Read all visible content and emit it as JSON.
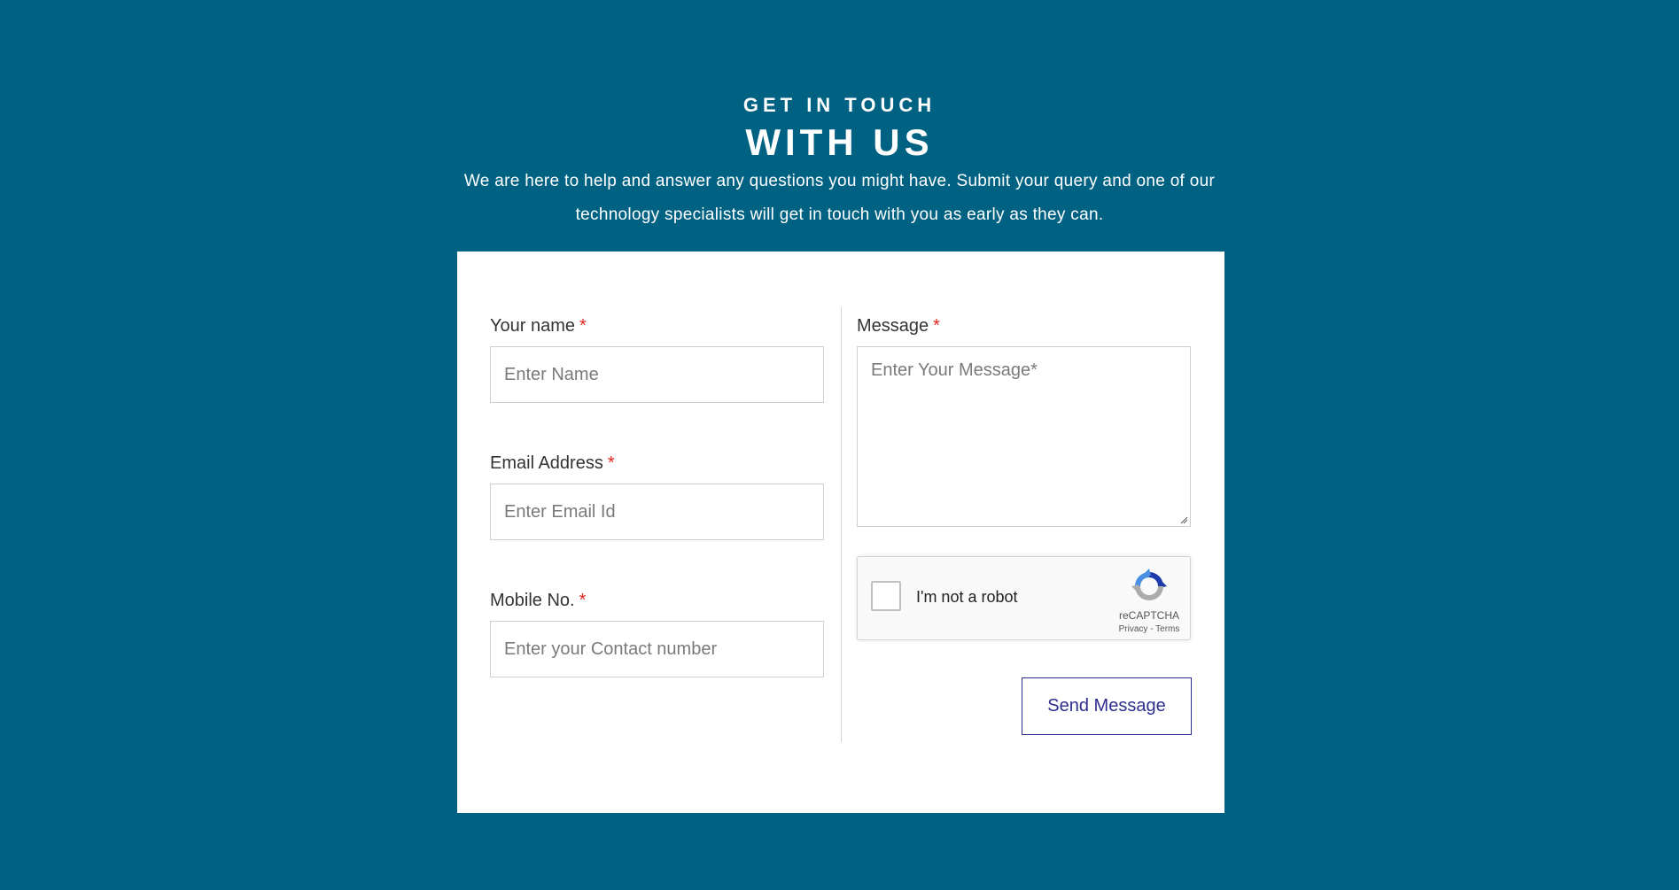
{
  "header": {
    "eyebrow": "GET IN TOUCH",
    "title": "WITH US",
    "intro": "We are here to help and answer any questions you might have. Submit your query and one of our technology specialists will get in touch with you as early as they can."
  },
  "form": {
    "name": {
      "label": "Your name",
      "required_mark": "*",
      "placeholder": "Enter Name",
      "value": ""
    },
    "email": {
      "label": "Email Address",
      "required_mark": "*",
      "placeholder": "Enter Email Id",
      "value": ""
    },
    "mobile": {
      "label": "Mobile No.",
      "required_mark": "*",
      "placeholder": "Enter your Contact number",
      "value": ""
    },
    "message": {
      "label": "Message",
      "required_mark": "*",
      "placeholder": "Enter Your Message*",
      "value": ""
    },
    "recaptcha": {
      "label": "I'm not a robot",
      "brand": "reCAPTCHA",
      "privacy": "Privacy",
      "separator": "-",
      "terms": "Terms",
      "checked": false,
      "logo_icon": "recaptcha-logo-icon"
    },
    "submit_label": "Send Message"
  },
  "colors": {
    "background": "#006283",
    "card": "#ffffff",
    "required": "#e0241b",
    "button": "#2e2e8f"
  }
}
